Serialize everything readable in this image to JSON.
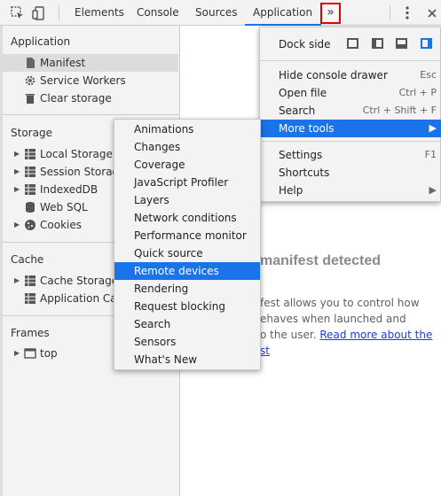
{
  "toolbar": {
    "tabs": [
      "Elements",
      "Console",
      "Sources",
      "Application"
    ],
    "active_tab": "Application",
    "more_tabs_label": "»",
    "accent": "#1a73e8",
    "highlight_border": "#e00000"
  },
  "sidebar": {
    "application": {
      "title": "Application",
      "items": [
        "Manifest",
        "Service Workers",
        "Clear storage"
      ]
    },
    "storage": {
      "title": "Storage",
      "items": [
        "Local Storage",
        "Session Storage",
        "IndexedDB",
        "Web SQL",
        "Cookies"
      ]
    },
    "cache": {
      "title": "Cache",
      "items": [
        "Cache Storage",
        "Application Cache"
      ]
    },
    "frames": {
      "title": "Frames",
      "items": [
        "top"
      ]
    }
  },
  "main": {
    "title": "manifest detected",
    "line1": "fest allows you to control how",
    "line2": "ehaves when launched and",
    "line3_prefix": "o the user. ",
    "line3_link": "Read more about the",
    "line4_link": "st"
  },
  "main_menu": {
    "dock_side_label": "Dock side",
    "items": [
      {
        "label": "Hide console drawer",
        "shortcut": "Esc"
      },
      {
        "label": "Open file",
        "shortcut": "Ctrl + P"
      },
      {
        "label": "Search",
        "shortcut": "Ctrl + Shift + F"
      },
      {
        "label": "More tools",
        "shortcut": "▶"
      },
      {
        "label": "Settings",
        "shortcut": "F1"
      },
      {
        "label": "Shortcuts",
        "shortcut": ""
      },
      {
        "label": "Help",
        "shortcut": "▶"
      }
    ]
  },
  "more_tools_menu": {
    "items": [
      "Animations",
      "Changes",
      "Coverage",
      "JavaScript Profiler",
      "Layers",
      "Network conditions",
      "Performance monitor",
      "Quick source",
      "Remote devices",
      "Rendering",
      "Request blocking",
      "Search",
      "Sensors",
      "What's New"
    ],
    "highlighted": "Remote devices"
  }
}
